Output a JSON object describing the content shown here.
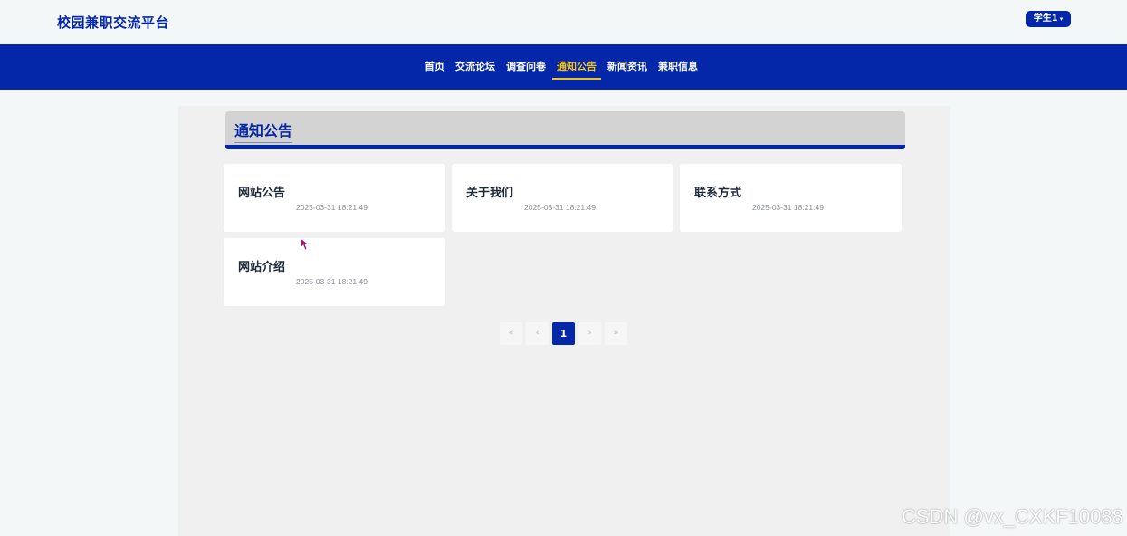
{
  "header": {
    "site_title": "校园兼职交流平台",
    "user_menu": {
      "label": "学生1",
      "caret": "▾"
    }
  },
  "nav": {
    "items": [
      {
        "label": "首页",
        "active": false
      },
      {
        "label": "交流论坛",
        "active": false
      },
      {
        "label": "调查问卷",
        "active": false
      },
      {
        "label": "通知公告",
        "active": true
      },
      {
        "label": "新闻资讯",
        "active": false
      },
      {
        "label": "兼职信息",
        "active": false
      }
    ]
  },
  "section": {
    "title": "通知公告"
  },
  "notices": [
    {
      "title": "网站公告",
      "time": "2025-03-31 18:21:49"
    },
    {
      "title": "关于我们",
      "time": "2025-03-31 18:21:49"
    },
    {
      "title": "联系方式",
      "time": "2025-03-31 18:21:49"
    },
    {
      "title": "网站介绍",
      "time": "2025-03-31 18:21:49"
    }
  ],
  "pagination": {
    "first": "«",
    "prev": "‹",
    "current": "1",
    "next": "›",
    "last": "»"
  },
  "watermark": "CSDN @vx_CXKF10088",
  "colors": {
    "primary": "#0426a8",
    "active_nav": "#f0c419",
    "page_bg": "#f4f7f8",
    "content_bg": "#f0f0f0"
  },
  "icons": {
    "cursor": "mouse-pointer-icon"
  }
}
